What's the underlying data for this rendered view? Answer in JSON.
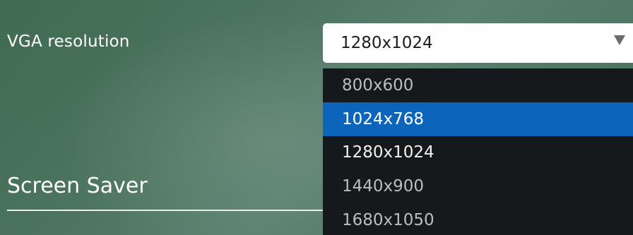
{
  "vga": {
    "label": "VGA resolution",
    "selected_value": "1280x1024",
    "options": [
      {
        "label": "800x600",
        "state": "normal"
      },
      {
        "label": "1024x768",
        "state": "highlighted"
      },
      {
        "label": "1280x1024",
        "state": "normal"
      },
      {
        "label": "1440x900",
        "state": "normal"
      },
      {
        "label": "1680x1050",
        "state": "normal"
      }
    ]
  },
  "screen_saver": {
    "title": "Screen Saver"
  },
  "icons": {
    "dropdown_arrow": "chevron-down-icon"
  },
  "colors": {
    "highlight": "#0c65bb",
    "dropdown_background": "#15191b",
    "select_background": "#ffffff"
  }
}
